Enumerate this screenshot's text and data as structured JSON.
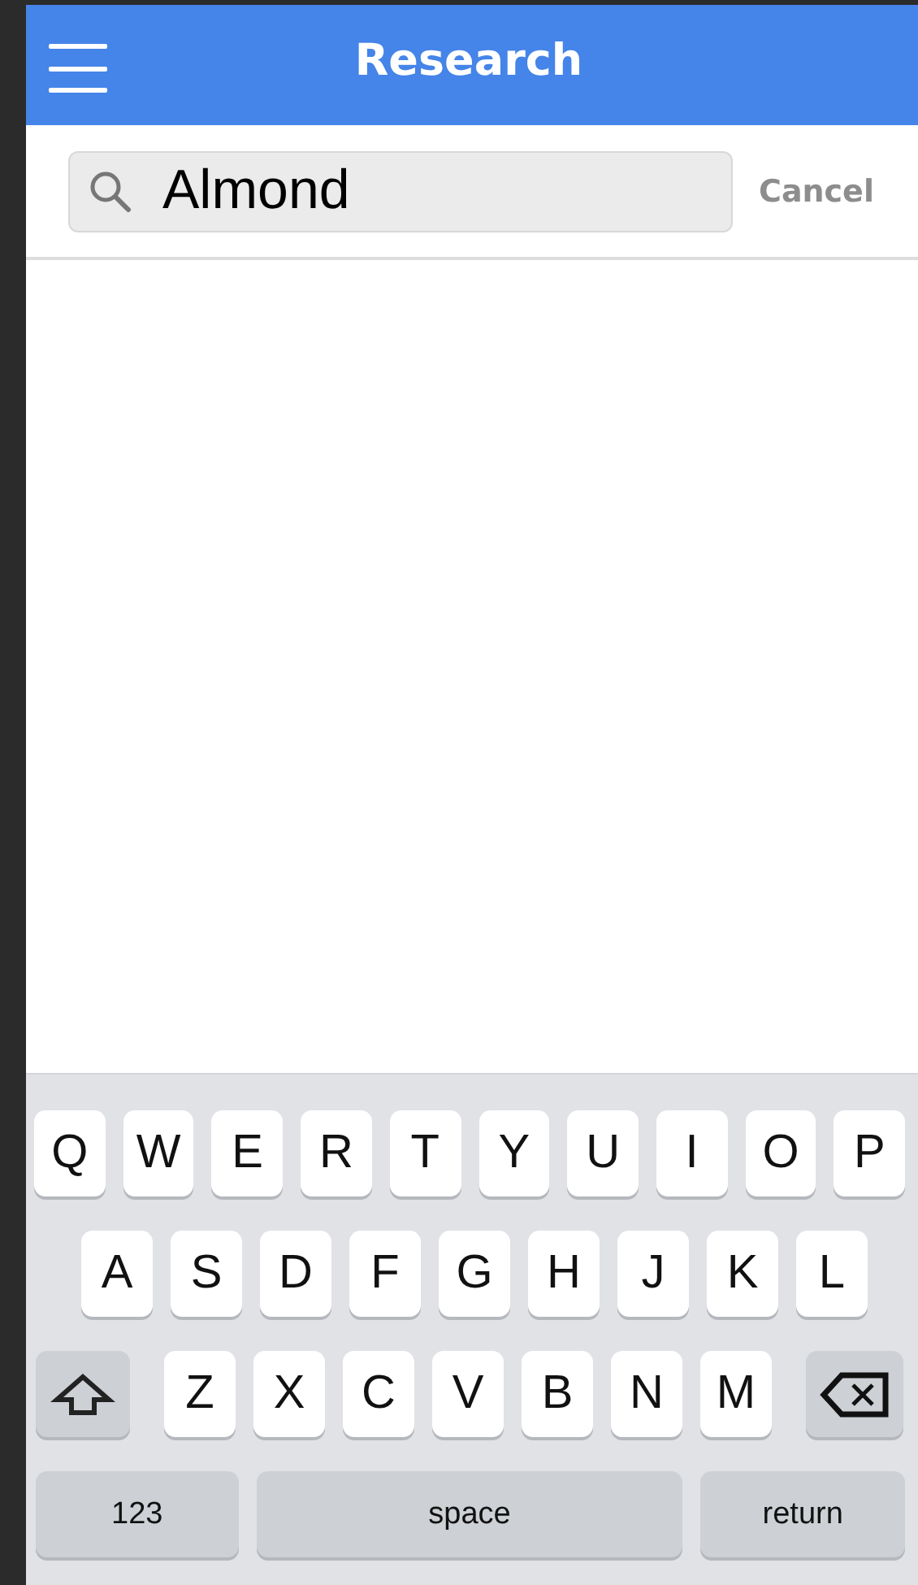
{
  "header": {
    "title": "Research"
  },
  "search": {
    "value": "Almond",
    "cancel": "Cancel"
  },
  "keyboard": {
    "rows": [
      {
        "keys": [
          {
            "kind": "letter",
            "label": "Q"
          },
          {
            "kind": "letter",
            "label": "W"
          },
          {
            "kind": "letter",
            "label": "E"
          },
          {
            "kind": "letter",
            "label": "R"
          },
          {
            "kind": "letter",
            "label": "T"
          },
          {
            "kind": "letter",
            "label": "Y"
          },
          {
            "kind": "letter",
            "label": "U"
          },
          {
            "kind": "letter",
            "label": "I"
          },
          {
            "kind": "letter",
            "label": "O"
          },
          {
            "kind": "letter",
            "label": "P"
          }
        ]
      },
      {
        "keys": [
          {
            "kind": "letter",
            "label": "A"
          },
          {
            "kind": "letter",
            "label": "S"
          },
          {
            "kind": "letter",
            "label": "D"
          },
          {
            "kind": "letter",
            "label": "F"
          },
          {
            "kind": "letter",
            "label": "G"
          },
          {
            "kind": "letter",
            "label": "H"
          },
          {
            "kind": "letter",
            "label": "J"
          },
          {
            "kind": "letter",
            "label": "K"
          },
          {
            "kind": "letter",
            "label": "L"
          }
        ]
      },
      {
        "keys": [
          {
            "kind": "shift"
          },
          {
            "kind": "letter",
            "label": "Z"
          },
          {
            "kind": "letter",
            "label": "X"
          },
          {
            "kind": "letter",
            "label": "C"
          },
          {
            "kind": "letter",
            "label": "V"
          },
          {
            "kind": "letter",
            "label": "B"
          },
          {
            "kind": "letter",
            "label": "N"
          },
          {
            "kind": "letter",
            "label": "M"
          },
          {
            "kind": "backspace"
          }
        ]
      },
      {
        "keys": [
          {
            "kind": "mode",
            "label": "123"
          },
          {
            "kind": "space",
            "label": "space"
          },
          {
            "kind": "return",
            "label": "return"
          }
        ]
      }
    ]
  }
}
